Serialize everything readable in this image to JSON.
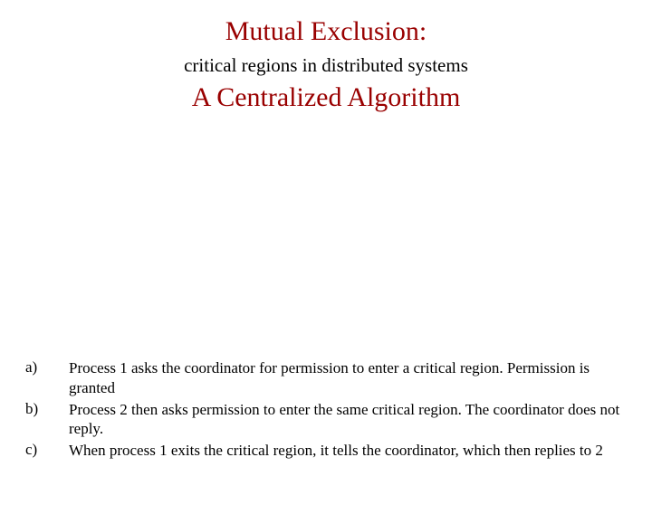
{
  "title1": "Mutual Exclusion:",
  "subtitle": "critical regions in distributed systems",
  "title2": "A Centralized Algorithm",
  "items": [
    {
      "label": "a)",
      "text": "Process 1 asks the coordinator for permission to enter a critical region. Permission is granted"
    },
    {
      "label": "b)",
      "text": "Process 2 then asks permission to enter the same critical region.  The coordinator does not reply."
    },
    {
      "label": "c)",
      "text": "When process 1 exits the critical region, it tells the coordinator, which then replies to 2"
    }
  ]
}
